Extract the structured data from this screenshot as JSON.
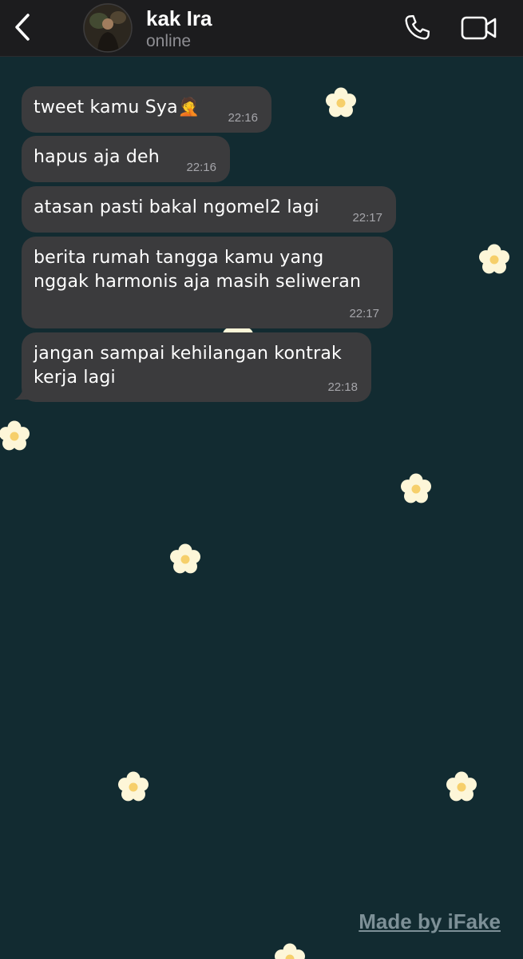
{
  "header": {
    "contact_name": "kak Ira",
    "status": "online",
    "back_icon": "chevron-left-icon",
    "call_icon": "phone-icon",
    "video_icon": "video-camera-icon"
  },
  "messages": [
    {
      "text": "tweet kamu Sya🤦",
      "time": "22:16"
    },
    {
      "text": "hapus aja deh",
      "time": "22:16"
    },
    {
      "text": "atasan pasti bakal ngomel2 lagi",
      "time": "22:17"
    },
    {
      "text_lines": [
        "berita rumah tangga kamu yang",
        "nggak harmonis aja masih seliweran"
      ],
      "time": "22:17"
    },
    {
      "text_lines": [
        "jangan sampai kehilangan kontrak",
        "kerja lagi"
      ],
      "time": "22:18"
    }
  ],
  "watermark": "Made by iFake",
  "colors": {
    "background": "#122b31",
    "header": "#1c1c1e",
    "bubble": "#3b3b3d",
    "flower_petal": "#fdf6d8",
    "flower_center": "#f6cf6a"
  }
}
